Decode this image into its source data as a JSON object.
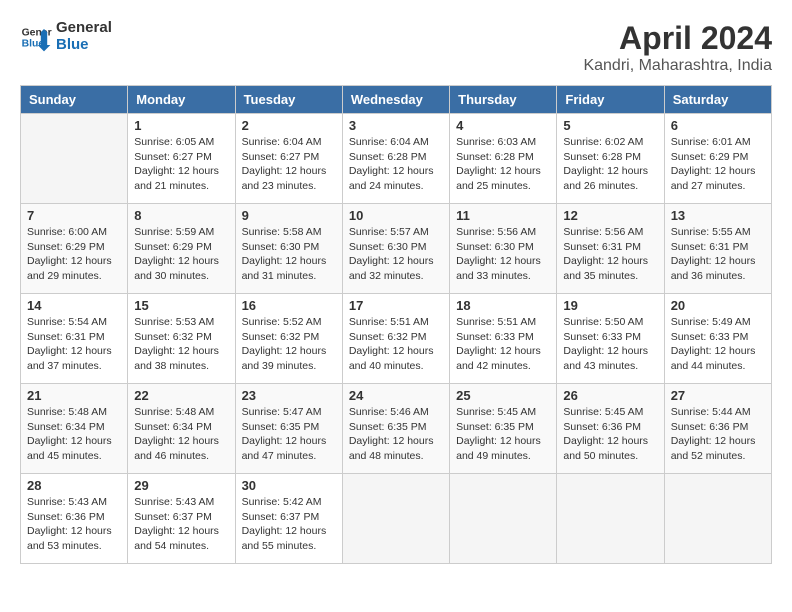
{
  "header": {
    "logo_line1": "General",
    "logo_line2": "Blue",
    "month_title": "April 2024",
    "location": "Kandri, Maharashtra, India"
  },
  "columns": [
    "Sunday",
    "Monday",
    "Tuesday",
    "Wednesday",
    "Thursday",
    "Friday",
    "Saturday"
  ],
  "weeks": [
    [
      {
        "day": "",
        "info": ""
      },
      {
        "day": "1",
        "info": "Sunrise: 6:05 AM\nSunset: 6:27 PM\nDaylight: 12 hours\nand 21 minutes."
      },
      {
        "day": "2",
        "info": "Sunrise: 6:04 AM\nSunset: 6:27 PM\nDaylight: 12 hours\nand 23 minutes."
      },
      {
        "day": "3",
        "info": "Sunrise: 6:04 AM\nSunset: 6:28 PM\nDaylight: 12 hours\nand 24 minutes."
      },
      {
        "day": "4",
        "info": "Sunrise: 6:03 AM\nSunset: 6:28 PM\nDaylight: 12 hours\nand 25 minutes."
      },
      {
        "day": "5",
        "info": "Sunrise: 6:02 AM\nSunset: 6:28 PM\nDaylight: 12 hours\nand 26 minutes."
      },
      {
        "day": "6",
        "info": "Sunrise: 6:01 AM\nSunset: 6:29 PM\nDaylight: 12 hours\nand 27 minutes."
      }
    ],
    [
      {
        "day": "7",
        "info": "Sunrise: 6:00 AM\nSunset: 6:29 PM\nDaylight: 12 hours\nand 29 minutes."
      },
      {
        "day": "8",
        "info": "Sunrise: 5:59 AM\nSunset: 6:29 PM\nDaylight: 12 hours\nand 30 minutes."
      },
      {
        "day": "9",
        "info": "Sunrise: 5:58 AM\nSunset: 6:30 PM\nDaylight: 12 hours\nand 31 minutes."
      },
      {
        "day": "10",
        "info": "Sunrise: 5:57 AM\nSunset: 6:30 PM\nDaylight: 12 hours\nand 32 minutes."
      },
      {
        "day": "11",
        "info": "Sunrise: 5:56 AM\nSunset: 6:30 PM\nDaylight: 12 hours\nand 33 minutes."
      },
      {
        "day": "12",
        "info": "Sunrise: 5:56 AM\nSunset: 6:31 PM\nDaylight: 12 hours\nand 35 minutes."
      },
      {
        "day": "13",
        "info": "Sunrise: 5:55 AM\nSunset: 6:31 PM\nDaylight: 12 hours\nand 36 minutes."
      }
    ],
    [
      {
        "day": "14",
        "info": "Sunrise: 5:54 AM\nSunset: 6:31 PM\nDaylight: 12 hours\nand 37 minutes."
      },
      {
        "day": "15",
        "info": "Sunrise: 5:53 AM\nSunset: 6:32 PM\nDaylight: 12 hours\nand 38 minutes."
      },
      {
        "day": "16",
        "info": "Sunrise: 5:52 AM\nSunset: 6:32 PM\nDaylight: 12 hours\nand 39 minutes."
      },
      {
        "day": "17",
        "info": "Sunrise: 5:51 AM\nSunset: 6:32 PM\nDaylight: 12 hours\nand 40 minutes."
      },
      {
        "day": "18",
        "info": "Sunrise: 5:51 AM\nSunset: 6:33 PM\nDaylight: 12 hours\nand 42 minutes."
      },
      {
        "day": "19",
        "info": "Sunrise: 5:50 AM\nSunset: 6:33 PM\nDaylight: 12 hours\nand 43 minutes."
      },
      {
        "day": "20",
        "info": "Sunrise: 5:49 AM\nSunset: 6:33 PM\nDaylight: 12 hours\nand 44 minutes."
      }
    ],
    [
      {
        "day": "21",
        "info": "Sunrise: 5:48 AM\nSunset: 6:34 PM\nDaylight: 12 hours\nand 45 minutes."
      },
      {
        "day": "22",
        "info": "Sunrise: 5:48 AM\nSunset: 6:34 PM\nDaylight: 12 hours\nand 46 minutes."
      },
      {
        "day": "23",
        "info": "Sunrise: 5:47 AM\nSunset: 6:35 PM\nDaylight: 12 hours\nand 47 minutes."
      },
      {
        "day": "24",
        "info": "Sunrise: 5:46 AM\nSunset: 6:35 PM\nDaylight: 12 hours\nand 48 minutes."
      },
      {
        "day": "25",
        "info": "Sunrise: 5:45 AM\nSunset: 6:35 PM\nDaylight: 12 hours\nand 49 minutes."
      },
      {
        "day": "26",
        "info": "Sunrise: 5:45 AM\nSunset: 6:36 PM\nDaylight: 12 hours\nand 50 minutes."
      },
      {
        "day": "27",
        "info": "Sunrise: 5:44 AM\nSunset: 6:36 PM\nDaylight: 12 hours\nand 52 minutes."
      }
    ],
    [
      {
        "day": "28",
        "info": "Sunrise: 5:43 AM\nSunset: 6:36 PM\nDaylight: 12 hours\nand 53 minutes."
      },
      {
        "day": "29",
        "info": "Sunrise: 5:43 AM\nSunset: 6:37 PM\nDaylight: 12 hours\nand 54 minutes."
      },
      {
        "day": "30",
        "info": "Sunrise: 5:42 AM\nSunset: 6:37 PM\nDaylight: 12 hours\nand 55 minutes."
      },
      {
        "day": "",
        "info": ""
      },
      {
        "day": "",
        "info": ""
      },
      {
        "day": "",
        "info": ""
      },
      {
        "day": "",
        "info": ""
      }
    ]
  ]
}
